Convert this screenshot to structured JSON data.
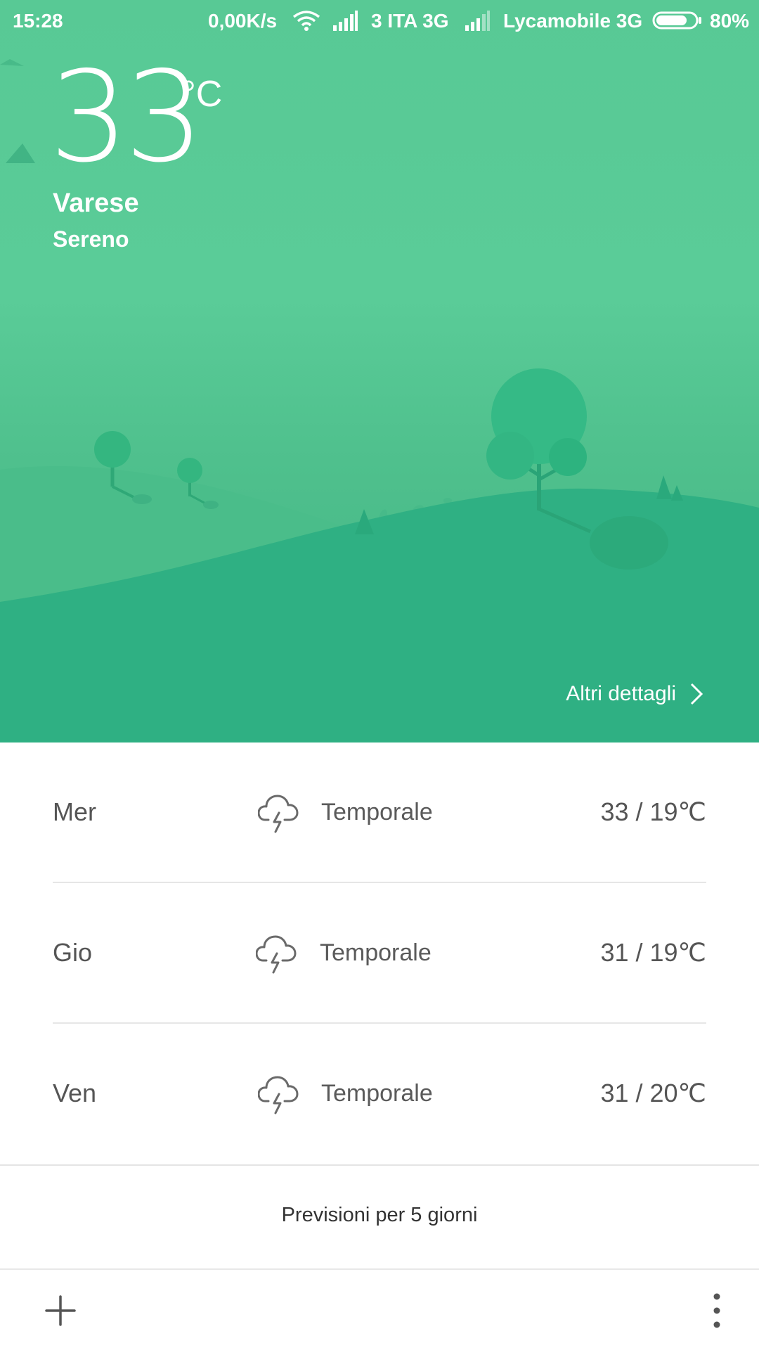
{
  "status_bar": {
    "time": "15:28",
    "network_speed": "0,00K/s",
    "carrier1": "3 ITA 3G",
    "carrier2": "Lycamobile 3G",
    "battery": "80%",
    "battery_level": 0.8,
    "icons": [
      "wifi-icon",
      "signal-icon",
      "signal-icon",
      "battery-icon"
    ]
  },
  "current": {
    "temperature": "33",
    "unit": "°C",
    "city": "Varese",
    "condition": "Sereno",
    "details_link": "Altri dettagli"
  },
  "forecast": [
    {
      "day": "Mer",
      "icon": "thunderstorm-icon",
      "condition": "Temporale",
      "range": "33 / 19℃"
    },
    {
      "day": "Gio",
      "icon": "thunderstorm-icon",
      "condition": "Temporale",
      "range": "31 / 19℃"
    },
    {
      "day": "Ven",
      "icon": "thunderstorm-icon",
      "condition": "Temporale",
      "range": "31 / 20℃"
    }
  ],
  "five_day_label": "Previsioni per 5 giorni",
  "toolbar": {
    "add_icon": "plus-icon",
    "menu_icon": "more-vertical-icon"
  },
  "colors": {
    "hero_green": "#58c995",
    "hill_dark": "#2fb083",
    "tree_green": "#2bb47f"
  }
}
